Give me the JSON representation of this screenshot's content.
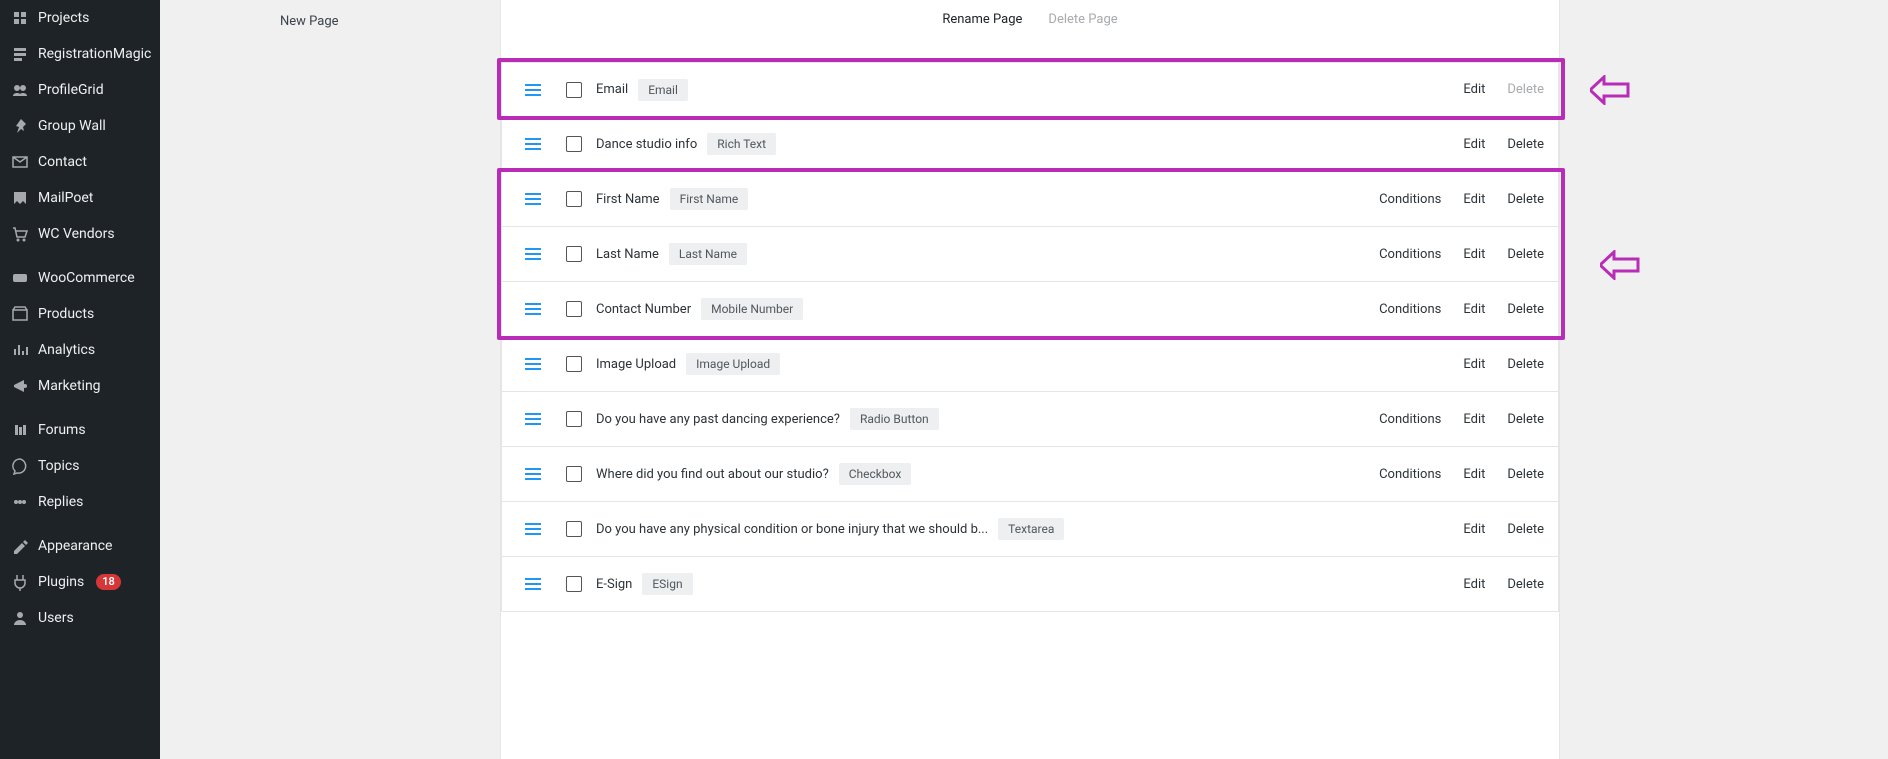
{
  "sidebar": {
    "items": [
      {
        "label": "Projects",
        "icon": "projects-icon"
      },
      {
        "label": "RegistrationMagic",
        "icon": "registration-icon"
      },
      {
        "label": "ProfileGrid",
        "icon": "profilegrid-icon"
      },
      {
        "label": "Group Wall",
        "icon": "pin-icon"
      },
      {
        "label": "Contact",
        "icon": "mail-icon"
      },
      {
        "label": "MailPoet",
        "icon": "mailpoet-icon"
      },
      {
        "label": "WC Vendors",
        "icon": "cart-icon"
      },
      {
        "label": "WooCommerce",
        "icon": "woocommerce-icon"
      },
      {
        "label": "Products",
        "icon": "products-icon"
      },
      {
        "label": "Analytics",
        "icon": "analytics-icon"
      },
      {
        "label": "Marketing",
        "icon": "marketing-icon"
      },
      {
        "label": "Forums",
        "icon": "forums-icon"
      },
      {
        "label": "Topics",
        "icon": "topics-icon"
      },
      {
        "label": "Replies",
        "icon": "replies-icon"
      },
      {
        "label": "Appearance",
        "icon": "appearance-icon"
      },
      {
        "label": "Plugins",
        "icon": "plugins-icon",
        "badge": "18"
      },
      {
        "label": "Users",
        "icon": "users-icon"
      }
    ]
  },
  "left_col": {
    "new_page_label": "New Page"
  },
  "top": {
    "rename_label": "Rename Page",
    "delete_label": "Delete Page"
  },
  "row_action_labels": {
    "conditions": "Conditions",
    "edit": "Edit",
    "delete": "Delete"
  },
  "fields": [
    {
      "name": "Email",
      "type": "Email",
      "conditions": false,
      "delete_enabled": false
    },
    {
      "name": "Dance studio info",
      "type": "Rich Text",
      "conditions": false,
      "delete_enabled": true
    },
    {
      "name": "First Name",
      "type": "First Name",
      "conditions": true,
      "delete_enabled": true
    },
    {
      "name": "Last Name",
      "type": "Last Name",
      "conditions": true,
      "delete_enabled": true
    },
    {
      "name": "Contact Number",
      "type": "Mobile Number",
      "conditions": true,
      "delete_enabled": true
    },
    {
      "name": "Image Upload",
      "type": "Image Upload",
      "conditions": false,
      "delete_enabled": true
    },
    {
      "name": "Do you have any past dancing experience?",
      "type": "Radio Button",
      "conditions": true,
      "delete_enabled": true
    },
    {
      "name": "Where did you find out about our studio?",
      "type": "Checkbox",
      "conditions": true,
      "delete_enabled": true
    },
    {
      "name": "Do you have any physical condition or bone injury that we should b...",
      "type": "Textarea",
      "conditions": false,
      "delete_enabled": true
    },
    {
      "name": "E-Sign",
      "type": "ESign",
      "conditions": false,
      "delete_enabled": true
    }
  ]
}
